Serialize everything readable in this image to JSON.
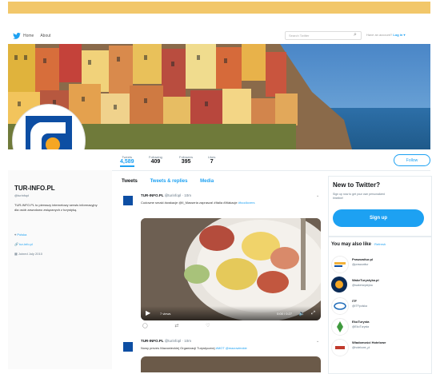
{
  "nav": {
    "home": "Home",
    "about": "About",
    "search_placeholder": "Search Twitter",
    "have_account": "Have an account?",
    "login": "Log in ▾"
  },
  "profile": {
    "name": "TUR-INFO.PL",
    "handle": "@turinfopl",
    "bio": "TUR-INFO.PL to pierwszy internetowy serwis informacyjny dla osób zawodowo związanych z turystyką.",
    "location": "Polska",
    "website": "tur-info.pl",
    "joined": "Joined July 2010"
  },
  "stats": [
    {
      "label": "Tweets",
      "value": "4,589"
    },
    {
      "label": "Following",
      "value": "409"
    },
    {
      "label": "Followers",
      "value": "395"
    },
    {
      "label": "Likes",
      "value": "7"
    }
  ],
  "follow_label": "Follow",
  "tabs": [
    "Tweets",
    "Tweets & replies",
    "Media"
  ],
  "tweets": [
    {
      "author": "TUR-INFO.PL",
      "handle": "@turinfopl · 10m",
      "text": "Cudowne smaki #wakacje @Il_Masseria zaprasza! #Italia #Wakacje",
      "tags": "#foodlovers"
    },
    {
      "author": "TUR-INFO.PL",
      "handle": "@turinfopl · 10m",
      "text": "Nowy prezes Mazowieckiej Organizacji Turystycznej ",
      "tags": "#MOT @mazowieckie"
    }
  ],
  "video": {
    "views": "7 views",
    "time": "0:00 / 0:27"
  },
  "right": {
    "new_title": "New to Twitter?",
    "new_sub": "Sign up now to get your own personalized timeline!",
    "signup": "Sign up",
    "may_like": "You may also like",
    "refresh": "· Refresh",
    "suggestions": [
      {
        "name": "Prawowitur.pl",
        "handle": "@prawowitur",
        "color": "#f3b23a"
      },
      {
        "name": "WakeTurystyka.pl",
        "handle": "@waketurystyka",
        "color": "#0a2a55"
      },
      {
        "name": "ITF",
        "handle": "@ITFpolska",
        "color": "#1e6bb8"
      },
      {
        "name": "EkoTurysta",
        "handle": "@EkoTurysta",
        "color": "#3f9a3d"
      },
      {
        "name": "Wiadomości Hotelowe",
        "handle": "@hotelowe_pl",
        "color": "#c0392b"
      }
    ]
  }
}
